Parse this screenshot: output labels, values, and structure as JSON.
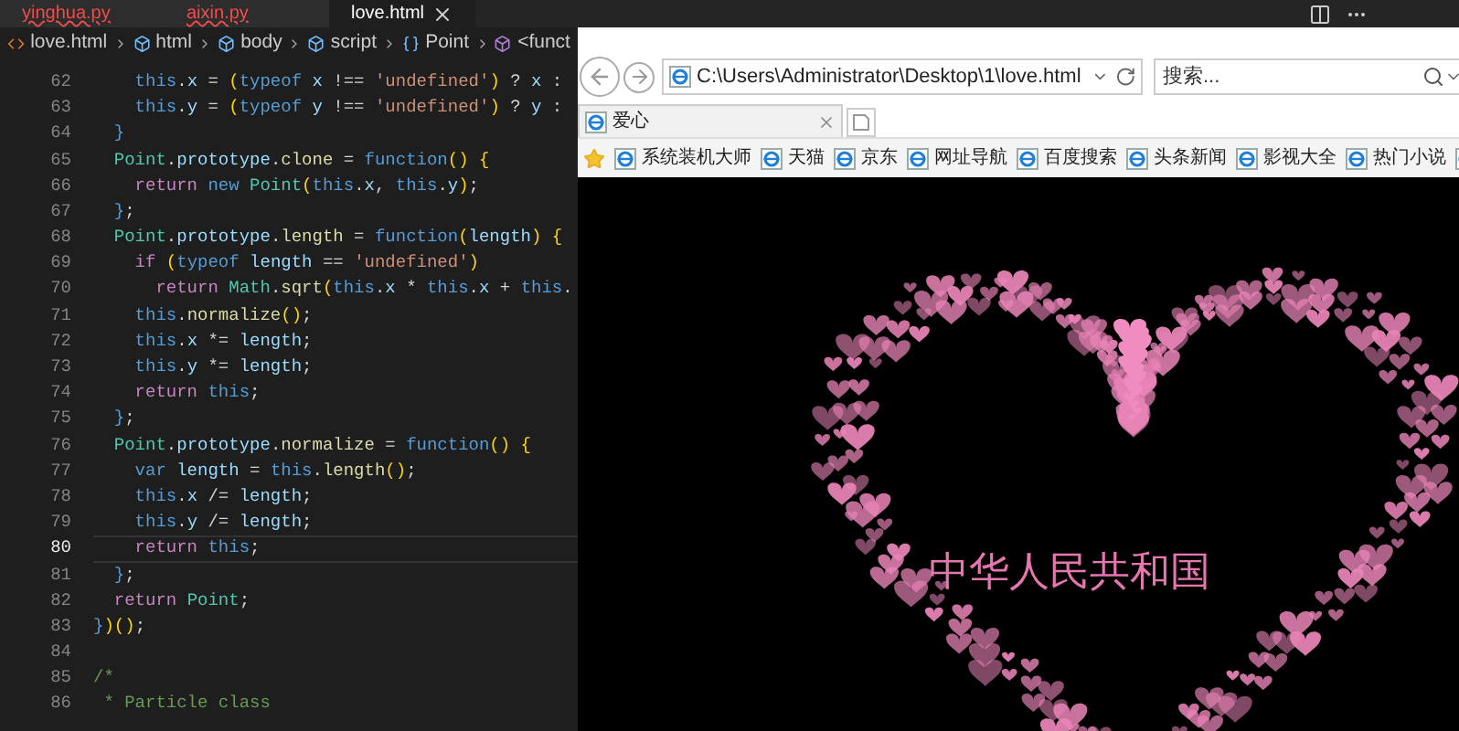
{
  "editor": {
    "tabs": [
      {
        "label": "yinghua.py",
        "selected": false,
        "error": true
      },
      {
        "label": "aixin.py",
        "selected": false,
        "error": true
      },
      {
        "label": "love.html",
        "selected": true,
        "error": false
      }
    ],
    "breadcrumb": [
      {
        "label": "love.html",
        "kind": "file"
      },
      {
        "label": "html",
        "kind": "element"
      },
      {
        "label": "body",
        "kind": "element"
      },
      {
        "label": "script",
        "kind": "element"
      },
      {
        "label": "Point",
        "kind": "variable"
      },
      {
        "label": "<funct",
        "kind": "function"
      }
    ],
    "lines": [
      {
        "number": "62",
        "current": false,
        "tokens": [
          {
            "kind": "keyword",
            "text": "    this"
          },
          {
            "kind": "plain",
            "text": "."
          },
          {
            "kind": "variable",
            "text": "x"
          },
          {
            "kind": "plain",
            "text": " = "
          },
          {
            "kind": "bracket",
            "text": "("
          },
          {
            "kind": "keyword",
            "text": "typeof "
          },
          {
            "kind": "variable",
            "text": "x"
          },
          {
            "kind": "plain",
            "text": " !== "
          },
          {
            "kind": "string",
            "text": "'undefined'"
          },
          {
            "kind": "bracket",
            "text": ")"
          },
          {
            "kind": "plain",
            "text": " ? "
          },
          {
            "kind": "variable",
            "text": "x"
          },
          {
            "kind": "plain",
            "text": " :"
          }
        ]
      },
      {
        "number": "63",
        "current": false,
        "tokens": [
          {
            "kind": "keyword",
            "text": "    this"
          },
          {
            "kind": "plain",
            "text": "."
          },
          {
            "kind": "variable",
            "text": "y"
          },
          {
            "kind": "plain",
            "text": " = "
          },
          {
            "kind": "bracket",
            "text": "("
          },
          {
            "kind": "keyword",
            "text": "typeof "
          },
          {
            "kind": "variable",
            "text": "y"
          },
          {
            "kind": "plain",
            "text": " !== "
          },
          {
            "kind": "string",
            "text": "'undefined'"
          },
          {
            "kind": "bracket",
            "text": ")"
          },
          {
            "kind": "plain",
            "text": " ? "
          },
          {
            "kind": "variable",
            "text": "y"
          },
          {
            "kind": "plain",
            "text": " :"
          }
        ]
      },
      {
        "number": "64",
        "current": false,
        "tokens": [
          {
            "kind": "keyword",
            "text": "  }"
          }
        ]
      },
      {
        "number": "65",
        "current": false,
        "tokens": [
          {
            "kind": "type",
            "text": "  Point"
          },
          {
            "kind": "plain",
            "text": "."
          },
          {
            "kind": "variable",
            "text": "prototype"
          },
          {
            "kind": "plain",
            "text": "."
          },
          {
            "kind": "function",
            "text": "clone"
          },
          {
            "kind": "plain",
            "text": " = "
          },
          {
            "kind": "keyword",
            "text": "function"
          },
          {
            "kind": "bracket",
            "text": "() {"
          }
        ]
      },
      {
        "number": "66",
        "current": false,
        "tokens": [
          {
            "kind": "control",
            "text": "    return "
          },
          {
            "kind": "keyword",
            "text": "new "
          },
          {
            "kind": "type",
            "text": "Point"
          },
          {
            "kind": "bracket",
            "text": "("
          },
          {
            "kind": "keyword",
            "text": "this"
          },
          {
            "kind": "plain",
            "text": "."
          },
          {
            "kind": "variable",
            "text": "x"
          },
          {
            "kind": "plain",
            "text": ", "
          },
          {
            "kind": "keyword",
            "text": "this"
          },
          {
            "kind": "plain",
            "text": "."
          },
          {
            "kind": "variable",
            "text": "y"
          },
          {
            "kind": "bracket",
            "text": ")"
          },
          {
            "kind": "plain",
            "text": ";"
          }
        ]
      },
      {
        "number": "67",
        "current": false,
        "tokens": [
          {
            "kind": "keyword",
            "text": "  }"
          },
          {
            "kind": "plain",
            "text": ";"
          }
        ]
      },
      {
        "number": "68",
        "current": false,
        "tokens": [
          {
            "kind": "type",
            "text": "  Point"
          },
          {
            "kind": "plain",
            "text": "."
          },
          {
            "kind": "variable",
            "text": "prototype"
          },
          {
            "kind": "plain",
            "text": "."
          },
          {
            "kind": "function",
            "text": "length"
          },
          {
            "kind": "plain",
            "text": " = "
          },
          {
            "kind": "keyword",
            "text": "function"
          },
          {
            "kind": "bracket",
            "text": "("
          },
          {
            "kind": "variable",
            "text": "length"
          },
          {
            "kind": "bracket",
            "text": ") {"
          }
        ]
      },
      {
        "number": "69",
        "current": false,
        "tokens": [
          {
            "kind": "control",
            "text": "    if "
          },
          {
            "kind": "bracket",
            "text": "("
          },
          {
            "kind": "keyword",
            "text": "typeof "
          },
          {
            "kind": "variable",
            "text": "length"
          },
          {
            "kind": "plain",
            "text": " == "
          },
          {
            "kind": "string",
            "text": "'undefined'"
          },
          {
            "kind": "bracket",
            "text": ")"
          }
        ]
      },
      {
        "number": "70",
        "current": false,
        "tokens": [
          {
            "kind": "control",
            "text": "      return "
          },
          {
            "kind": "type",
            "text": "Math"
          },
          {
            "kind": "plain",
            "text": "."
          },
          {
            "kind": "function",
            "text": "sqrt"
          },
          {
            "kind": "bracket",
            "text": "("
          },
          {
            "kind": "keyword",
            "text": "this"
          },
          {
            "kind": "plain",
            "text": "."
          },
          {
            "kind": "variable",
            "text": "x"
          },
          {
            "kind": "plain",
            "text": " * "
          },
          {
            "kind": "keyword",
            "text": "this"
          },
          {
            "kind": "plain",
            "text": "."
          },
          {
            "kind": "variable",
            "text": "x"
          },
          {
            "kind": "plain",
            "text": " + "
          },
          {
            "kind": "keyword",
            "text": "this"
          },
          {
            "kind": "plain",
            "text": "."
          }
        ]
      },
      {
        "number": "71",
        "current": false,
        "tokens": [
          {
            "kind": "keyword",
            "text": "    this"
          },
          {
            "kind": "plain",
            "text": "."
          },
          {
            "kind": "function",
            "text": "normalize"
          },
          {
            "kind": "bracket",
            "text": "()"
          },
          {
            "kind": "plain",
            "text": ";"
          }
        ]
      },
      {
        "number": "72",
        "current": false,
        "tokens": [
          {
            "kind": "keyword",
            "text": "    this"
          },
          {
            "kind": "plain",
            "text": "."
          },
          {
            "kind": "variable",
            "text": "x"
          },
          {
            "kind": "plain",
            "text": " *= "
          },
          {
            "kind": "variable",
            "text": "length"
          },
          {
            "kind": "plain",
            "text": ";"
          }
        ]
      },
      {
        "number": "73",
        "current": false,
        "tokens": [
          {
            "kind": "keyword",
            "text": "    this"
          },
          {
            "kind": "plain",
            "text": "."
          },
          {
            "kind": "variable",
            "text": "y"
          },
          {
            "kind": "plain",
            "text": " *= "
          },
          {
            "kind": "variable",
            "text": "length"
          },
          {
            "kind": "plain",
            "text": ";"
          }
        ]
      },
      {
        "number": "74",
        "current": false,
        "tokens": [
          {
            "kind": "control",
            "text": "    return "
          },
          {
            "kind": "keyword",
            "text": "this"
          },
          {
            "kind": "plain",
            "text": ";"
          }
        ]
      },
      {
        "number": "75",
        "current": false,
        "tokens": [
          {
            "kind": "keyword",
            "text": "  }"
          },
          {
            "kind": "plain",
            "text": ";"
          }
        ]
      },
      {
        "number": "76",
        "current": false,
        "tokens": [
          {
            "kind": "type",
            "text": "  Point"
          },
          {
            "kind": "plain",
            "text": "."
          },
          {
            "kind": "variable",
            "text": "prototype"
          },
          {
            "kind": "plain",
            "text": "."
          },
          {
            "kind": "function",
            "text": "normalize"
          },
          {
            "kind": "plain",
            "text": " = "
          },
          {
            "kind": "keyword",
            "text": "function"
          },
          {
            "kind": "bracket",
            "text": "() {"
          }
        ]
      },
      {
        "number": "77",
        "current": false,
        "tokens": [
          {
            "kind": "keyword",
            "text": "    var "
          },
          {
            "kind": "variable",
            "text": "length"
          },
          {
            "kind": "plain",
            "text": " = "
          },
          {
            "kind": "keyword",
            "text": "this"
          },
          {
            "kind": "plain",
            "text": "."
          },
          {
            "kind": "function",
            "text": "length"
          },
          {
            "kind": "bracket",
            "text": "()"
          },
          {
            "kind": "plain",
            "text": ";"
          }
        ]
      },
      {
        "number": "78",
        "current": false,
        "tokens": [
          {
            "kind": "keyword",
            "text": "    this"
          },
          {
            "kind": "plain",
            "text": "."
          },
          {
            "kind": "variable",
            "text": "x"
          },
          {
            "kind": "plain",
            "text": " /= "
          },
          {
            "kind": "variable",
            "text": "length"
          },
          {
            "kind": "plain",
            "text": ";"
          }
        ]
      },
      {
        "number": "79",
        "current": false,
        "tokens": [
          {
            "kind": "keyword",
            "text": "    this"
          },
          {
            "kind": "plain",
            "text": "."
          },
          {
            "kind": "variable",
            "text": "y"
          },
          {
            "kind": "plain",
            "text": " /= "
          },
          {
            "kind": "variable",
            "text": "length"
          },
          {
            "kind": "plain",
            "text": ";"
          }
        ]
      },
      {
        "number": "80",
        "current": true,
        "tokens": [
          {
            "kind": "control",
            "text": "    return "
          },
          {
            "kind": "keyword",
            "text": "this"
          },
          {
            "kind": "plain",
            "text": ";"
          }
        ]
      },
      {
        "number": "81",
        "current": false,
        "tokens": [
          {
            "kind": "keyword",
            "text": "  }"
          },
          {
            "kind": "plain",
            "text": ";"
          }
        ]
      },
      {
        "number": "82",
        "current": false,
        "tokens": [
          {
            "kind": "control",
            "text": "  return "
          },
          {
            "kind": "type",
            "text": "Point"
          },
          {
            "kind": "plain",
            "text": ";"
          }
        ]
      },
      {
        "number": "83",
        "current": false,
        "tokens": [
          {
            "kind": "keyword",
            "text": "}"
          },
          {
            "kind": "bracket",
            "text": ")()"
          },
          {
            "kind": "plain",
            "text": ";"
          }
        ]
      },
      {
        "number": "84",
        "current": false
      },
      {
        "number": "85",
        "current": false,
        "tokens": [
          {
            "kind": "comment",
            "text": "/*"
          }
        ]
      },
      {
        "number": "86",
        "current": false,
        "tokens": [
          {
            "kind": "comment",
            "text": " * Particle class"
          }
        ]
      }
    ]
  },
  "browser": {
    "address": "C:\\Users\\Administrator\\Desktop\\1\\love.html",
    "search": {
      "placeholder": "搜索..."
    },
    "tabs": [
      {
        "label": "爱心",
        "selected": true
      }
    ],
    "favorites": [
      "系统装机大师",
      "天猫",
      "京东",
      "网址导航",
      "百度搜索",
      "头条新闻",
      "影视大全",
      "热门小说"
    ],
    "page": {
      "heading": "中华人民共和国"
    }
  }
}
